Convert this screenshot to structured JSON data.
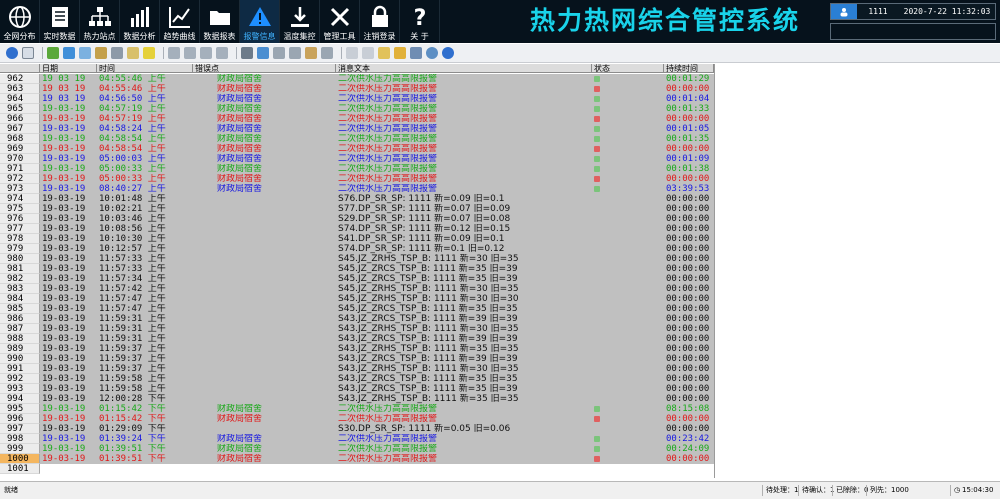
{
  "app": {
    "title": "热力热网综合管控系统"
  },
  "colors": {
    "green": "#18a818",
    "red": "#e01818",
    "blue": "#1818e0",
    "black": "#101010",
    "accent": "#19d3ea"
  },
  "nav": [
    {
      "label": "全网分布",
      "icon": "globe-icon"
    },
    {
      "label": "实时数据",
      "icon": "document-icon"
    },
    {
      "label": "热力站点",
      "icon": "network-icon"
    },
    {
      "label": "数据分析",
      "icon": "bar-chart-icon"
    },
    {
      "label": "趋势曲线",
      "icon": "trend-chart-icon"
    },
    {
      "label": "数据报表",
      "icon": "folder-icon"
    },
    {
      "label": "报警信息",
      "icon": "warning-icon",
      "active": true
    },
    {
      "label": "温度集控",
      "icon": "download-icon"
    },
    {
      "label": "管理工具",
      "icon": "tools-icon"
    },
    {
      "label": "注销登录",
      "icon": "lock-icon"
    },
    {
      "label": "关  于",
      "icon": "help-icon"
    }
  ],
  "user": {
    "name": "1111",
    "datetime": "2020-7-22 11:32:03"
  },
  "grid": {
    "columns": [
      "日期",
      "时间",
      "错误点",
      "消息文本",
      "状态",
      "持续时间"
    ],
    "rows": [
      {
        "idx": "962",
        "date": "19 03 19",
        "time": "04:55:46 上午",
        "err": "财政局宿舍",
        "msg": "二次供水压力高高限报警",
        "state": "g",
        "dur": "00:01:29",
        "color": "green"
      },
      {
        "idx": "963",
        "date": "19 03 19",
        "time": "04:55:46 上午",
        "err": "财政局宿舍",
        "msg": "二次供水压力高高限报警",
        "state": "r",
        "dur": "00:00:00",
        "color": "red"
      },
      {
        "idx": "964",
        "date": "19 03 19",
        "time": "04:56:50 上午",
        "err": "财政局宿舍",
        "msg": "二次供水压力高高限报警",
        "state": "g",
        "dur": "00:01:04",
        "color": "blue"
      },
      {
        "idx": "965",
        "date": "19-03-19",
        "time": "04:57:19 上午",
        "err": "财政局宿舍",
        "msg": "二次供水压力高高限报警",
        "state": "g",
        "dur": "00:01:33",
        "color": "green"
      },
      {
        "idx": "966",
        "date": "19-03-19",
        "time": "04:57:19 上午",
        "err": "财政局宿舍",
        "msg": "二次供水压力高高限报警",
        "state": "r",
        "dur": "00:00:00",
        "color": "red"
      },
      {
        "idx": "967",
        "date": "19-03-19",
        "time": "04:58:24 上午",
        "err": "财政局宿舍",
        "msg": "二次供水压力高高限报警",
        "state": "g",
        "dur": "00:01:05",
        "color": "blue"
      },
      {
        "idx": "968",
        "date": "19-03-19",
        "time": "04:58:54 上午",
        "err": "财政局宿舍",
        "msg": "二次供水压力高高限报警",
        "state": "g",
        "dur": "00:01:35",
        "color": "green"
      },
      {
        "idx": "969",
        "date": "19-03-19",
        "time": "04:58:54 上午",
        "err": "财政局宿舍",
        "msg": "二次供水压力高高限报警",
        "state": "r",
        "dur": "00:00:00",
        "color": "red"
      },
      {
        "idx": "970",
        "date": "19-03-19",
        "time": "05:00:03 上午",
        "err": "财政局宿舍",
        "msg": "二次供水压力高高限报警",
        "state": "g",
        "dur": "00:01:09",
        "color": "blue"
      },
      {
        "idx": "971",
        "date": "19-03-19",
        "time": "05:00:33 上午",
        "err": "财政局宿舍",
        "msg": "二次供水压力高高限报警",
        "state": "g",
        "dur": "00:01:38",
        "color": "green"
      },
      {
        "idx": "972",
        "date": "19-03-19",
        "time": "05:00:33 上午",
        "err": "财政局宿舍",
        "msg": "二次供水压力高高限报警",
        "state": "r",
        "dur": "00:00:00",
        "color": "red"
      },
      {
        "idx": "973",
        "date": "19-03-19",
        "time": "08:40:27 上午",
        "err": "财政局宿舍",
        "msg": "二次供水压力高高限报警",
        "state": "g",
        "dur": "03:39:53",
        "color": "blue"
      },
      {
        "idx": "974",
        "date": "19-03-19",
        "time": "10:01:48 上午",
        "err": "",
        "msg": "S76.DP_SR_SP:  1111 新=0.09  旧=0.1",
        "state": "",
        "dur": "00:00:00",
        "color": "black"
      },
      {
        "idx": "975",
        "date": "19-03-19",
        "time": "10:02:21 上午",
        "err": "",
        "msg": "S77.DP_SR_SP:  1111 新=0.07  旧=0.09",
        "state": "",
        "dur": "00:00:00",
        "color": "black"
      },
      {
        "idx": "976",
        "date": "19-03-19",
        "time": "10:03:46 上午",
        "err": "",
        "msg": "S29.DP_SR_SP:  1111 新=0.07  旧=0.08",
        "state": "",
        "dur": "00:00:00",
        "color": "black"
      },
      {
        "idx": "977",
        "date": "19-03-19",
        "time": "10:08:56 上午",
        "err": "",
        "msg": "S74.DP_SR_SP:  1111 新=0.12  旧=0.15",
        "state": "",
        "dur": "00:00:00",
        "color": "black"
      },
      {
        "idx": "978",
        "date": "19-03-19",
        "time": "10:10:30 上午",
        "err": "",
        "msg": "S41.DP_SR_SP:  1111 新=0.09  旧=0.1",
        "state": "",
        "dur": "00:00:00",
        "color": "black"
      },
      {
        "idx": "979",
        "date": "19-03-19",
        "time": "10:12:57 上午",
        "err": "",
        "msg": "S74.DP_SR_SP:  1111 新=0.1  旧=0.12",
        "state": "",
        "dur": "00:00:00",
        "color": "black"
      },
      {
        "idx": "980",
        "date": "19-03-19",
        "time": "11:57:33 上午",
        "err": "",
        "msg": "S45.JZ_ZRHS_TSP_B:  1111 新=30  旧=35",
        "state": "",
        "dur": "00:00:00",
        "color": "black"
      },
      {
        "idx": "981",
        "date": "19-03-19",
        "time": "11:57:33 上午",
        "err": "",
        "msg": "S45.JZ_ZRCS_TSP_B:  1111 新=35  旧=39",
        "state": "",
        "dur": "00:00:00",
        "color": "black"
      },
      {
        "idx": "982",
        "date": "19-03-19",
        "time": "11:57:34 上午",
        "err": "",
        "msg": "S45.JZ_ZRCS_TSP_B:  1111 新=35  旧=39",
        "state": "",
        "dur": "00:00:00",
        "color": "black"
      },
      {
        "idx": "983",
        "date": "19-03-19",
        "time": "11:57:42 上午",
        "err": "",
        "msg": "S45.JZ_ZRHS_TSP_B:  1111 新=30  旧=35",
        "state": "",
        "dur": "00:00:00",
        "color": "black"
      },
      {
        "idx": "984",
        "date": "19-03-19",
        "time": "11:57:47 上午",
        "err": "",
        "msg": "S45.JZ_ZRHS_TSP_B:  1111 新=30  旧=30",
        "state": "",
        "dur": "00:00:00",
        "color": "black"
      },
      {
        "idx": "985",
        "date": "19-03-19",
        "time": "11:57:47 上午",
        "err": "",
        "msg": "S45.JZ_ZRCS_TSP_B:  1111 新=35  旧=35",
        "state": "",
        "dur": "00:00:00",
        "color": "black"
      },
      {
        "idx": "986",
        "date": "19-03-19",
        "time": "11:59:31 上午",
        "err": "",
        "msg": "S43.JZ_ZRCS_TSP_B:  1111 新=39  旧=39",
        "state": "",
        "dur": "00:00:00",
        "color": "black"
      },
      {
        "idx": "987",
        "date": "19-03-19",
        "time": "11:59:31 上午",
        "err": "",
        "msg": "S43.JZ_ZRHS_TSP_B:  1111 新=30  旧=35",
        "state": "",
        "dur": "00:00:00",
        "color": "black"
      },
      {
        "idx": "988",
        "date": "19-03-19",
        "time": "11:59:31 上午",
        "err": "",
        "msg": "S43.JZ_ZRCS_TSP_B:  1111 新=39  旧=39",
        "state": "",
        "dur": "00:00:00",
        "color": "black"
      },
      {
        "idx": "989",
        "date": "19-03-19",
        "time": "11:59:37 上午",
        "err": "",
        "msg": "S43.JZ_ZRHS_TSP_B:  1111 新=35  旧=35",
        "state": "",
        "dur": "00:00:00",
        "color": "black"
      },
      {
        "idx": "990",
        "date": "19-03-19",
        "time": "11:59:37 上午",
        "err": "",
        "msg": "S43.JZ_ZRCS_TSP_B:  1111 新=39  旧=39",
        "state": "",
        "dur": "00:00:00",
        "color": "black"
      },
      {
        "idx": "991",
        "date": "19-03-19",
        "time": "11:59:37 上午",
        "err": "",
        "msg": "S43.JZ_ZRHS_TSP_B:  1111 新=30  旧=35",
        "state": "",
        "dur": "00:00:00",
        "color": "black"
      },
      {
        "idx": "992",
        "date": "19-03-19",
        "time": "11:59:58 上午",
        "err": "",
        "msg": "S43.JZ_ZRCS_TSP_B:  1111 新=35  旧=35",
        "state": "",
        "dur": "00:00:00",
        "color": "black"
      },
      {
        "idx": "993",
        "date": "19-03-19",
        "time": "11:59:58 上午",
        "err": "",
        "msg": "S43.JZ_ZRCS_TSP_B:  1111 新=35  旧=39",
        "state": "",
        "dur": "00:00:00",
        "color": "black"
      },
      {
        "idx": "994",
        "date": "19-03-19",
        "time": "12:00:28 下午",
        "err": "",
        "msg": "S43.JZ_ZRHS_TSP_B:  1111 新=35  旧=35",
        "state": "",
        "dur": "00:00:00",
        "color": "black"
      },
      {
        "idx": "995",
        "date": "19-03-19",
        "time": "01:15:42 下午",
        "err": "财政局宿舍",
        "msg": "二次供水压力高高限报警",
        "state": "g",
        "dur": "08:15:08",
        "color": "green"
      },
      {
        "idx": "996",
        "date": "19-03-19",
        "time": "01:15:42 下午",
        "err": "财政局宿舍",
        "msg": "二次供水压力高高限报警",
        "state": "r",
        "dur": "00:00:00",
        "color": "red"
      },
      {
        "idx": "997",
        "date": "19-03-19",
        "time": "01:29:09 下午",
        "err": "",
        "msg": "S30.DP_SR_SP:  1111 新=0.05  旧=0.06",
        "state": "",
        "dur": "00:00:00",
        "color": "black"
      },
      {
        "idx": "998",
        "date": "19-03-19",
        "time": "01:39:24 下午",
        "err": "财政局宿舍",
        "msg": "二次供水压力高高限报警",
        "state": "g",
        "dur": "00:23:42",
        "color": "blue"
      },
      {
        "idx": "999",
        "date": "19-03-19",
        "time": "01:39:51 下午",
        "err": "财政局宿舍",
        "msg": "二次供水压力高高限报警",
        "state": "g",
        "dur": "00:24:09",
        "color": "green"
      },
      {
        "idx": "1000",
        "date": "19-03-19",
        "time": "01:39:51 下午",
        "err": "财政局宿舍",
        "msg": "二次供水压力高高限报警",
        "state": "r",
        "dur": "00:00:00",
        "color": "red",
        "selected": true
      },
      {
        "idx": "1001",
        "date": "",
        "time": "",
        "err": "",
        "msg": "",
        "state": "",
        "dur": "",
        "color": "black",
        "empty": true
      }
    ]
  },
  "statusbar": {
    "left": "就绪",
    "unhandled": "待处理：1",
    "confirmed": "待确认：1",
    "deleted": "已除除：0",
    "rows": "列先：1000",
    "time": "15:04:30"
  }
}
